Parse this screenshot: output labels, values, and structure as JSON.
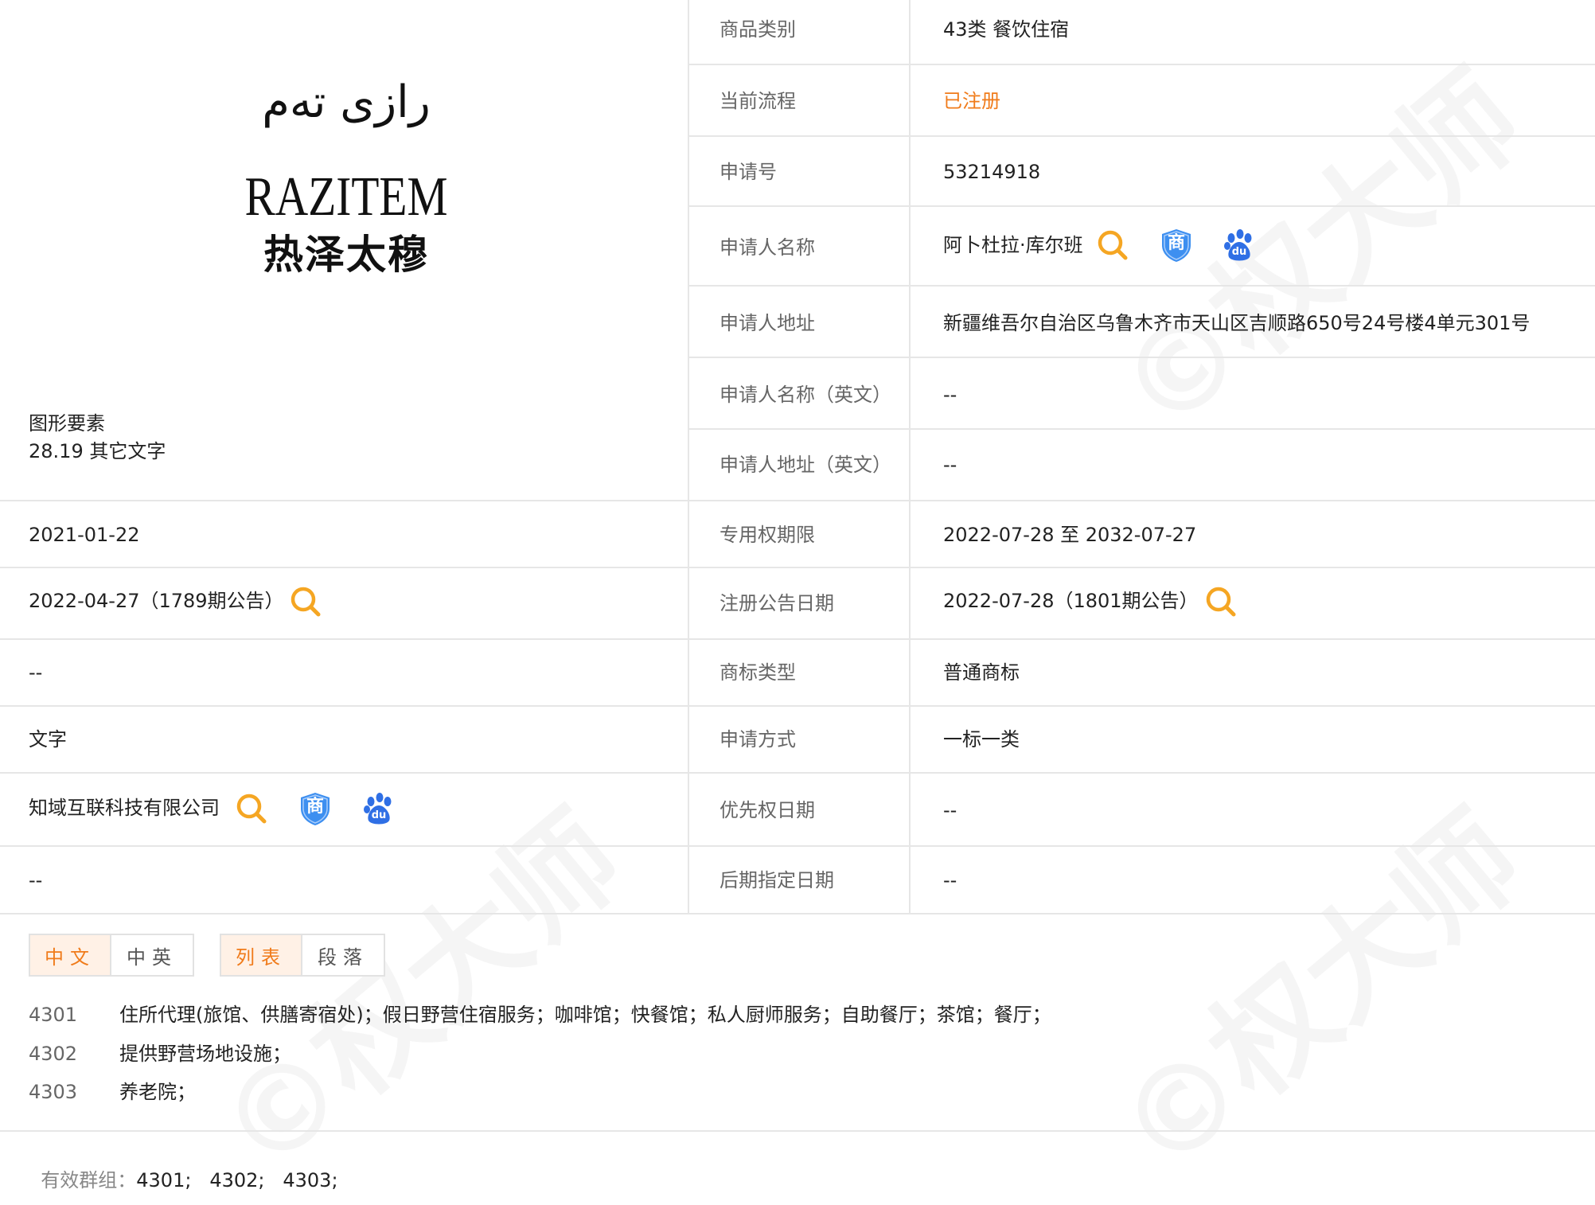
{
  "watermark_text": "©权大师",
  "logo": {
    "uyghur_text": "رازى تەم",
    "latin_text": "RAZITEM",
    "chinese_text": "热泽太穆"
  },
  "graphic_elements": {
    "label": "图形要素",
    "value": "28.19 其它文字"
  },
  "left_rows": {
    "application_date": "2021-01-22",
    "preliminary_notice": "2022-04-27（1789期公告）",
    "row3": "--",
    "trademark_form": "文字",
    "agent": "知域互联科技有限公司",
    "row6": "--"
  },
  "details": [
    {
      "label": "商品类别",
      "value": "43类 餐饮住宿"
    },
    {
      "label": "当前流程",
      "value": "已注册"
    },
    {
      "label": "申请号",
      "value": "53214918"
    },
    {
      "label": "申请人名称",
      "value": "阿卜杜拉·库尔班"
    },
    {
      "label": "申请人地址",
      "value": "新疆维吾尔自治区乌鲁木齐市天山区吉顺路650号24号楼4单元301号"
    },
    {
      "label": "申请人名称（英文）",
      "value": "--"
    },
    {
      "label": "申请人地址（英文）",
      "value": "--"
    },
    {
      "label": "专用权期限",
      "value": "2022-07-28 至 2032-07-27"
    },
    {
      "label": "注册公告日期",
      "value": "2022-07-28（1801期公告）"
    },
    {
      "label": "商标类型",
      "value": "普通商标"
    },
    {
      "label": "申请方式",
      "value": "一标一类"
    },
    {
      "label": "优先权日期",
      "value": "--"
    },
    {
      "label": "后期指定日期",
      "value": "--"
    }
  ],
  "status_color": "#f07b1a",
  "icons": {
    "search": "search-icon",
    "shang": "shang-shield-icon",
    "baidu": "baidu-paw-icon",
    "shang_glyph": "商",
    "baidu_glyph": "du"
  },
  "tabs": {
    "lang": [
      "中文",
      "中英"
    ],
    "view": [
      "列表",
      "段落"
    ]
  },
  "goods": [
    {
      "code": "4301",
      "text": "住所代理(旅馆、供膳寄宿处)；假日野营住宿服务；咖啡馆；快餐馆；私人厨师服务；自助餐厅；茶馆；餐厅；"
    },
    {
      "code": "4302",
      "text": "提供野营场地设施；"
    },
    {
      "code": "4303",
      "text": "养老院；"
    }
  ],
  "valid_groups": {
    "label": "有效群组：",
    "value": "4301;   4302;   4303;"
  }
}
